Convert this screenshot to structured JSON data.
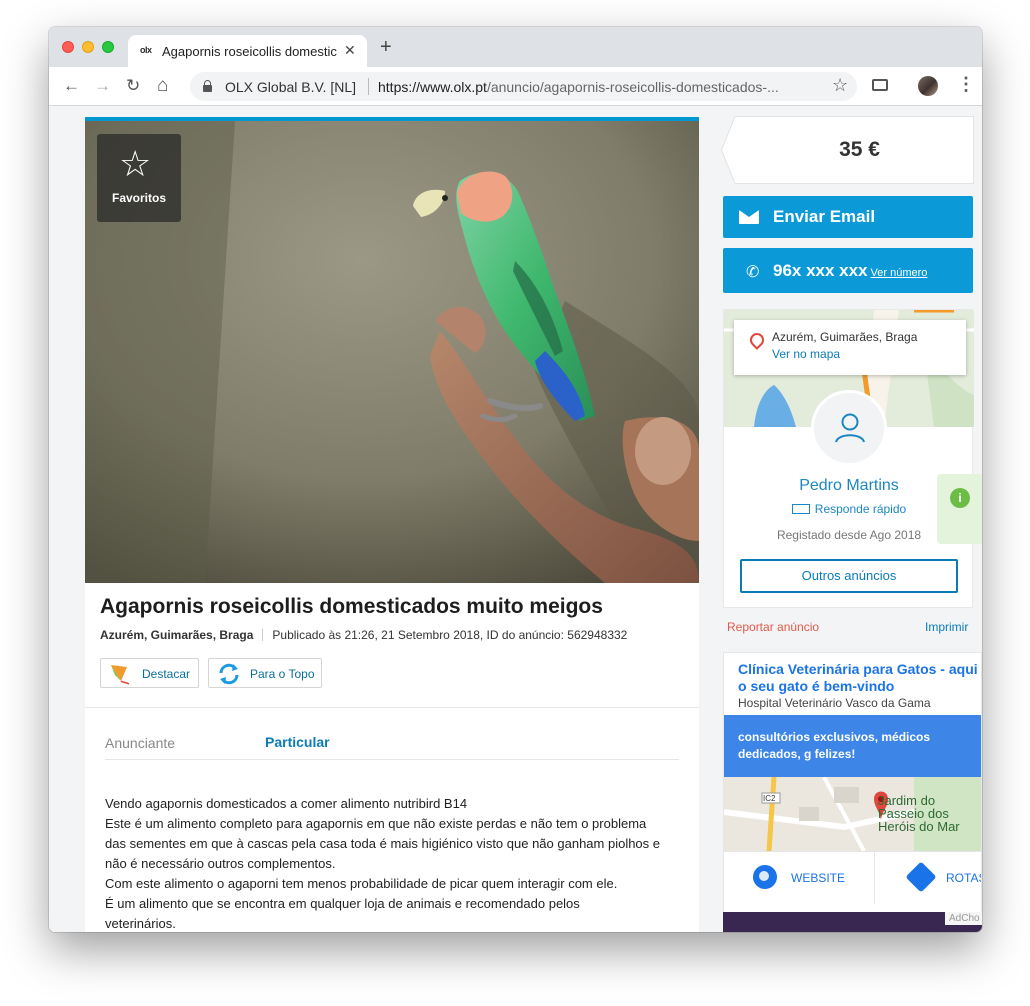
{
  "browser": {
    "tab_title": "Agapornis roseicollis domestic",
    "tab_favicon_text": "olx",
    "close_glyph": "✕",
    "new_tab_glyph": "+",
    "back_glyph": "←",
    "forward_glyph": "→",
    "reload_glyph": "↻",
    "home_glyph": "⌂",
    "site_org": "OLX Global B.V. [NL]",
    "url_host": "https://www.olx.pt",
    "url_path": "/anuncio/agapornis-roseicollis-domesticados-...",
    "bookmark_glyph": "☆",
    "menu_glyph": "⋮"
  },
  "listing": {
    "favorite_glyph": "☆",
    "favorite_label": "Favoritos",
    "title": "Agapornis roseicollis domesticados muito meigos",
    "location": "Azurém, Guimarães, Braga",
    "published": "Publicado às 21:26, 21 Setembro 2018, ID do anúncio: 562948332",
    "promote_label": "Destacar",
    "bump_label": "Para o Topo",
    "advertiser_label": "Anunciante",
    "advertiser_value": "Particular",
    "description": [
      "Vendo agapornis domesticados a comer alimento nutribird B14",
      "Este é um alimento completo para agapornis em que não existe perdas e não tem o problema",
      "das sementes em que à cascas pela casa toda é mais higiénico visto que não ganham piolhos e",
      "não é necessário outros complementos.",
      "Com este alimento o agaporni tem menos probabilidade de picar quem interagir com ele.",
      "É um alimento que se encontra em qualquer loja de animais e recomendado pelos",
      "veterinários."
    ]
  },
  "sidebar": {
    "price": "35 €",
    "email_label": "Enviar Email",
    "phone_icon": "✆",
    "phone_masked": "96x xxx xxx",
    "phone_reveal": "Ver número",
    "map_location": "Azurém, Guimarães, Braga",
    "map_link": "Ver no mapa",
    "user_name": "Pedro Martins",
    "fast_reply": "Responde rápido",
    "registered": "Registado desde Ago 2018",
    "other_ads": "Outros anúncios",
    "info_glyph": "i",
    "report": "Reportar anúncio",
    "print": "Imprimir"
  },
  "advert": {
    "headline": "Clínica Veterinária para Gatos - aqui o seu gato é bem-vindo",
    "subline": "Hospital Veterinário Vasco da Gama",
    "blurb": "consultórios exclusivos, médicos dedicados, g felizes!",
    "map_label_1": "Jardim do",
    "map_label_2": "Passeio dos",
    "map_label_3": "Heróis do Mar",
    "road_label": "IC2",
    "website": "WEBSITE",
    "routes": "ROTAS",
    "adchoices": "AdCho"
  },
  "colors": {
    "olx_blue": "#0b9ad7",
    "link_blue": "#0b7bb8",
    "report_red": "#e05a4c",
    "ad_blue": "#3d86e8"
  }
}
